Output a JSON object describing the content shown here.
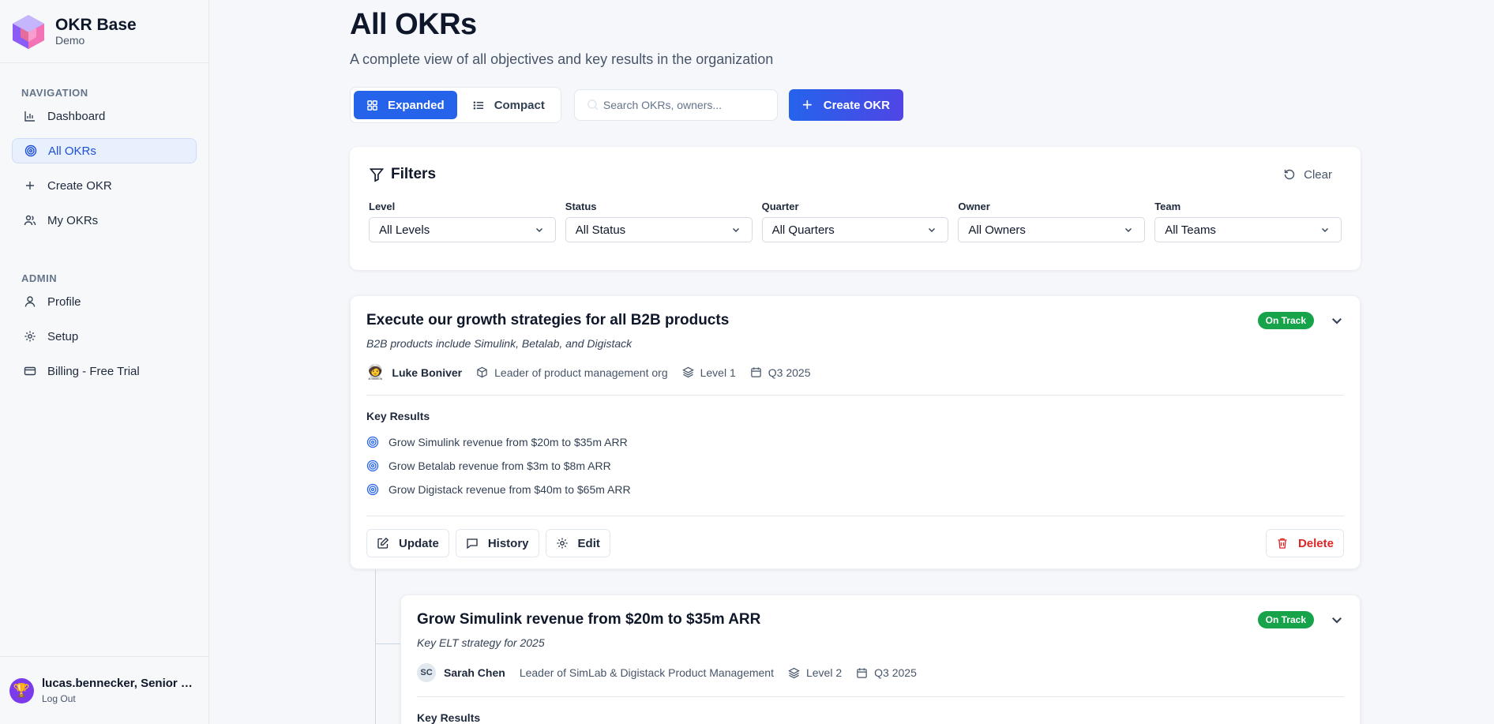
{
  "brand": {
    "title": "OKR Base",
    "subtitle": "Demo"
  },
  "nav": {
    "heading": "NAVIGATION",
    "items": [
      {
        "label": "Dashboard",
        "icon": "bar-chart-icon"
      },
      {
        "label": "All OKRs",
        "icon": "target-icon",
        "active": true
      },
      {
        "label": "Create OKR",
        "icon": "plus-icon"
      },
      {
        "label": "My OKRs",
        "icon": "users-icon"
      }
    ]
  },
  "admin": {
    "heading": "ADMIN",
    "items": [
      {
        "label": "Profile",
        "icon": "user-icon"
      },
      {
        "label": "Setup",
        "icon": "gear-icon"
      },
      {
        "label": "Billing - Free Trial",
        "icon": "credit-card-icon"
      }
    ]
  },
  "user": {
    "name": "lucas.bennecker, Senior Prod...",
    "logout": "Log Out"
  },
  "page": {
    "title": "All OKRs",
    "subtitle": "A complete view of all objectives and key results in the organization"
  },
  "toolbar": {
    "expanded": "Expanded",
    "compact": "Compact",
    "search_placeholder": "Search OKRs, owners...",
    "create": "Create OKR"
  },
  "filters": {
    "title": "Filters",
    "clear": "Clear",
    "fields": [
      {
        "label": "Level",
        "value": "All Levels"
      },
      {
        "label": "Status",
        "value": "All Status"
      },
      {
        "label": "Quarter",
        "value": "All Quarters"
      },
      {
        "label": "Owner",
        "value": "All Owners"
      },
      {
        "label": "Team",
        "value": "All Teams"
      }
    ]
  },
  "okrs": [
    {
      "title": "Execute our growth strategies for all B2B products",
      "status": "On Track",
      "description": "B2B products include Simulink, Betalab, and Digistack",
      "owner": "Luke Boniver",
      "team": "Leader of product management org",
      "level": "Level 1",
      "quarter": "Q3 2025",
      "kr_heading": "Key Results",
      "key_results": [
        "Grow Simulink revenue from $20m to $35m ARR",
        "Grow Betalab revenue from $3m to $8m ARR",
        "Grow Digistack revenue from $40m to $65m ARR"
      ],
      "actions": {
        "update": "Update",
        "history": "History",
        "edit": "Edit",
        "delete": "Delete"
      }
    },
    {
      "title": "Grow Simulink revenue from $20m to $35m ARR",
      "status": "On Track",
      "description": "Key ELT strategy for 2025",
      "owner_initials": "SC",
      "owner": "Sarah Chen",
      "team": "Leader of SimLab & Digistack Product Management",
      "level": "Level 2",
      "quarter": "Q3 2025",
      "kr_heading": "Key Results"
    }
  ],
  "colors": {
    "accent": "#2563eb",
    "success": "#16a34a",
    "danger": "#dc2626"
  }
}
